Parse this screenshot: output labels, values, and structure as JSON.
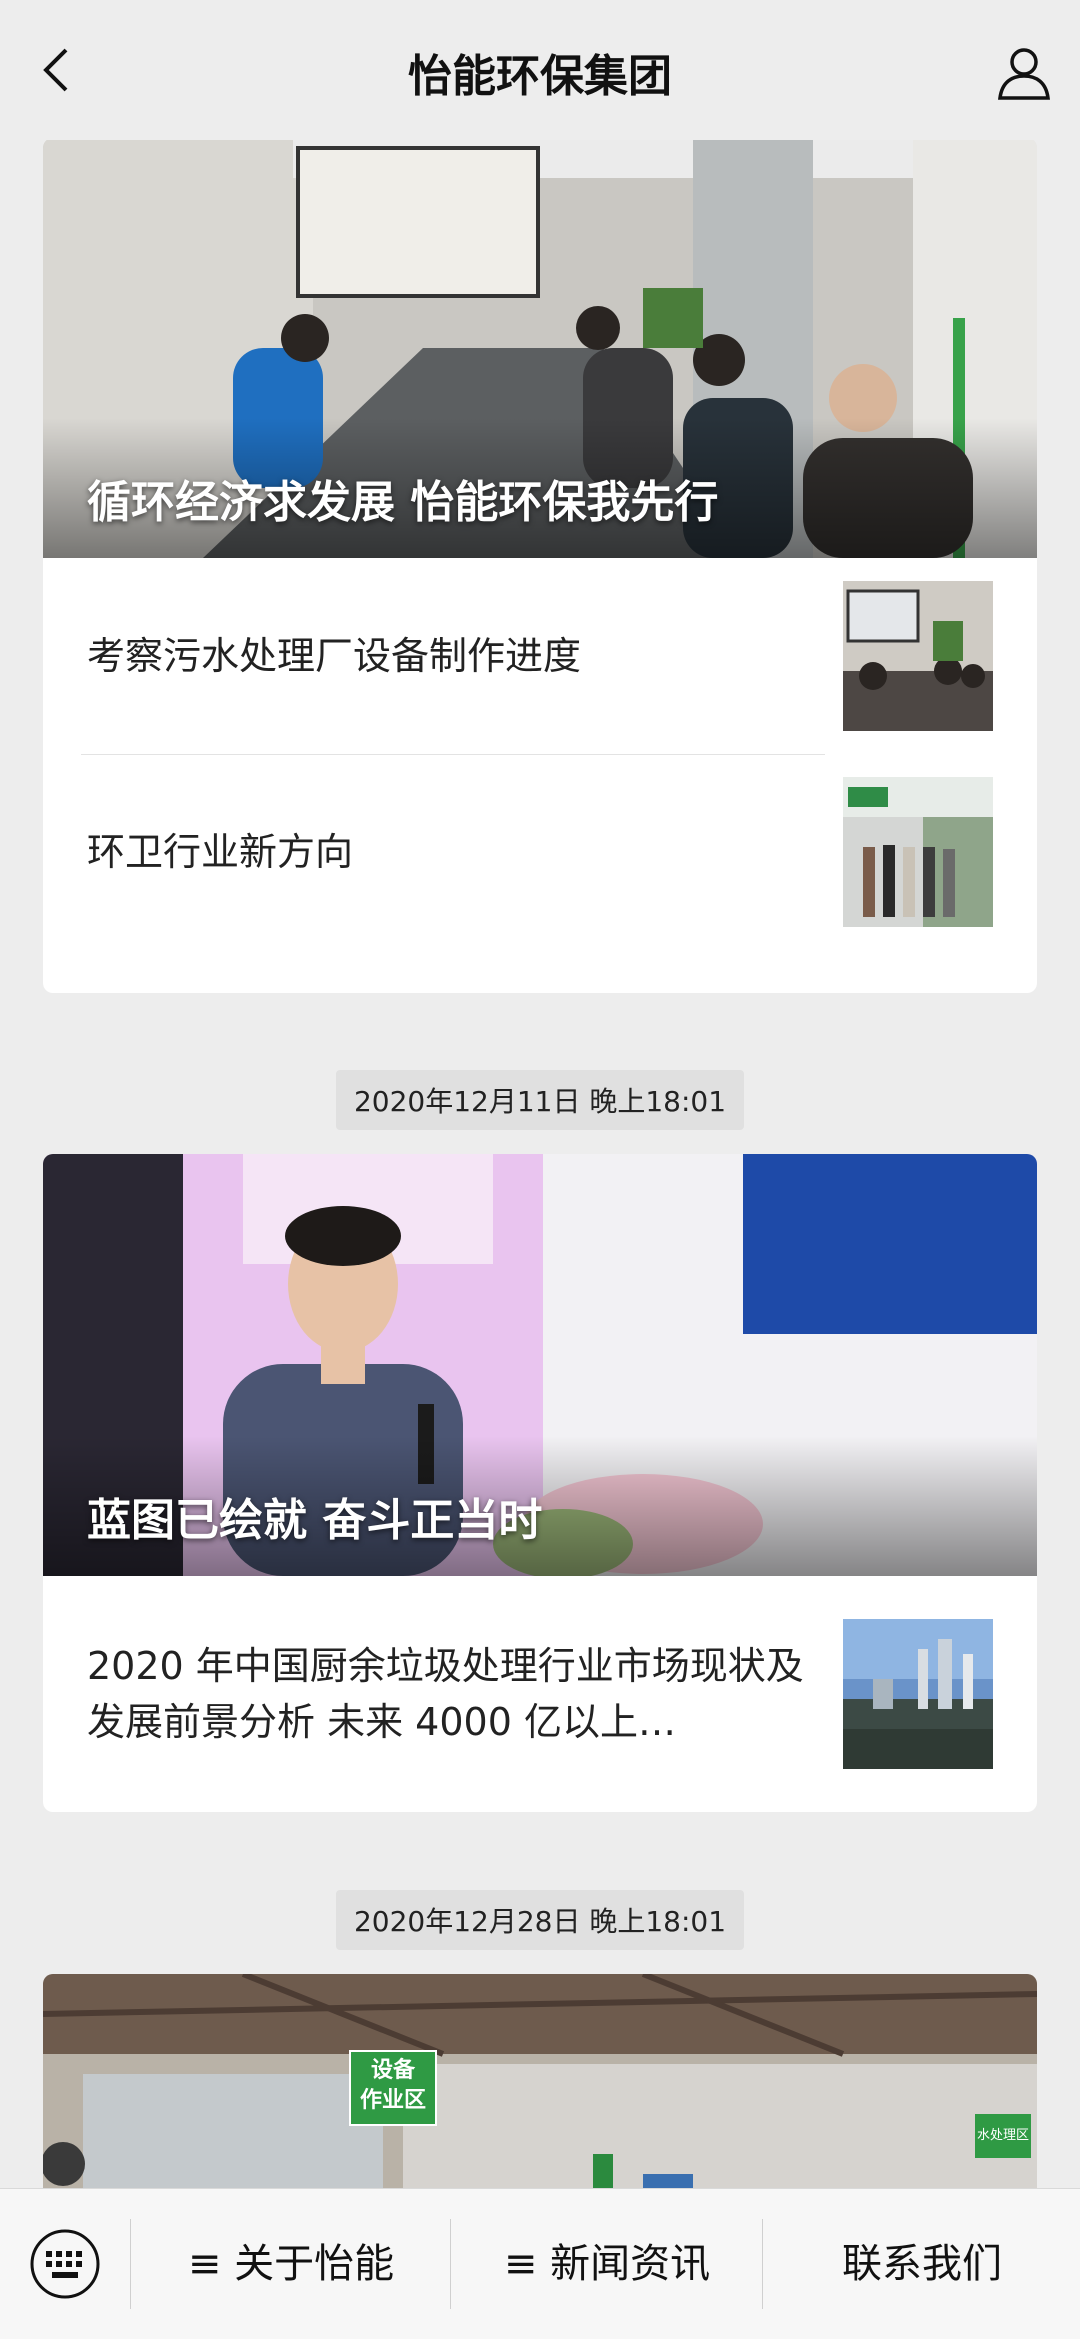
{
  "header": {
    "title": "怡能环保集团",
    "back_icon": "chevron-left-icon",
    "profile_icon": "user-icon"
  },
  "feed": {
    "card1": {
      "hero_caption": "循环经济求发展 怡能环保我先行",
      "items": [
        {
          "title": "考察污水处理厂设备制作进度"
        },
        {
          "title": "环卫行业新方向"
        }
      ]
    },
    "timestamp1": "2020年12月11日 晚上18:01",
    "card2": {
      "hero_caption": "蓝图已绘就 奋斗正当时",
      "items": [
        {
          "title": "2020 年中国厨余垃圾处理行业市场现状及发展前景分析 未来 4000 亿以上…"
        }
      ]
    },
    "timestamp2": "2020年12月28日 晚上18:01",
    "card3": {
      "photo_labels": [
        "设备",
        "作业区",
        "水处理区"
      ]
    }
  },
  "bottom_menu": {
    "keyboard_icon": "keyboard-icon",
    "items": [
      {
        "label": "≡ 关于怡能"
      },
      {
        "label": "≡ 新闻资讯"
      },
      {
        "label": "联系我们"
      }
    ]
  }
}
